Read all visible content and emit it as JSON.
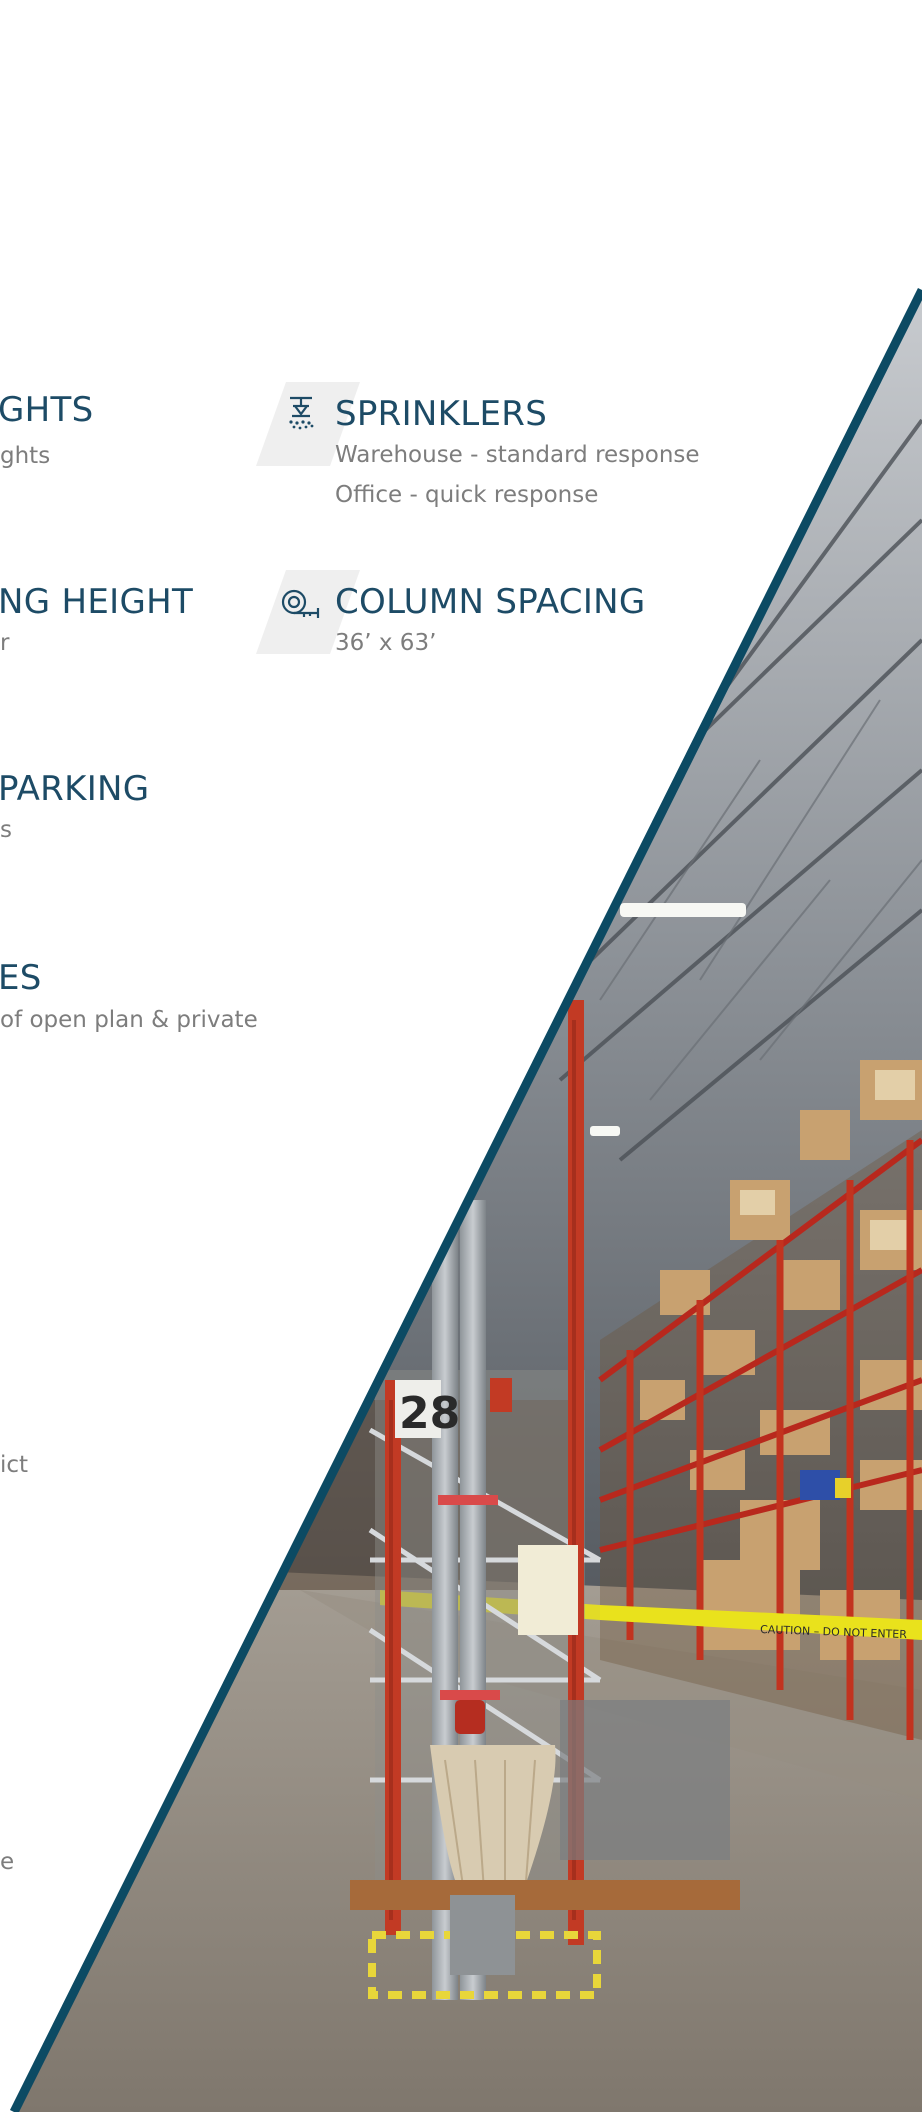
{
  "specs": [
    {
      "id": "skylights",
      "title": "GHTS",
      "lines": [
        "ghts"
      ]
    },
    {
      "id": "sprinklers",
      "title": "SPRINKLERS",
      "lines": [
        "Warehouse - standard response",
        "Office - quick response"
      ],
      "icon": "sprinkler-icon"
    },
    {
      "id": "clear-height",
      "title": "NG HEIGHT",
      "lines": [
        "r"
      ]
    },
    {
      "id": "column-spacing",
      "title": "COLUMN SPACING",
      "lines": [
        "36’ x 63’"
      ],
      "icon": "tape-measure-icon"
    },
    {
      "id": "parking",
      "title": "PARKING",
      "lines": [
        "s"
      ]
    },
    {
      "id": "offices",
      "title": "ES",
      "lines": [
        "of open plan & private"
      ]
    }
  ],
  "fragments": {
    "frag1": "ict",
    "frag2": "e"
  },
  "photo": {
    "rack_number": "28",
    "caution_tape": "CAUTION – DO NOT ENTER"
  },
  "colors": {
    "heading": "#1d4b66",
    "body_text": "#7d7d7d",
    "diagonal_border": "#0c4a63",
    "badge_bg": "#efefef"
  }
}
